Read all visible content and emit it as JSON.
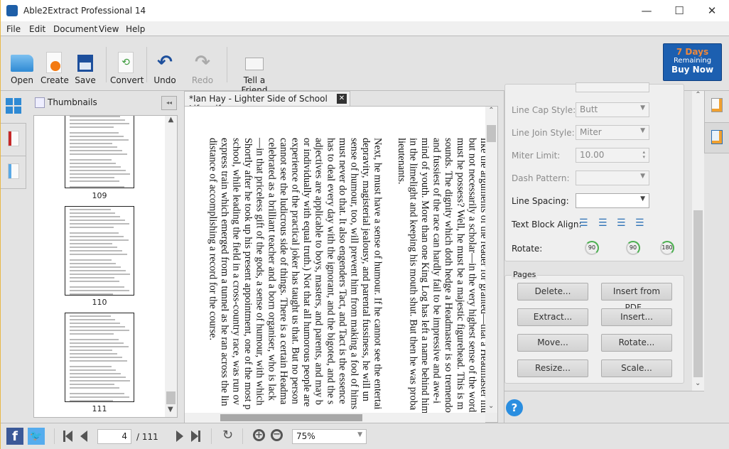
{
  "window": {
    "title": "Able2Extract Professional 14",
    "minimize": "—",
    "maximize": "☐",
    "close": "✕"
  },
  "menu": [
    "File",
    "Edit",
    "Document",
    "View",
    "Help"
  ],
  "toolbar": {
    "open": "Open",
    "create": "Create",
    "save": "Save",
    "convert": "Convert",
    "undo": "Undo",
    "redo": "Redo",
    "tell": "Tell a Friend"
  },
  "buy": {
    "days": "7 Days",
    "remaining": "Remaining",
    "buy": "Buy Now",
    "accent": "#1c5fb0",
    "days_color": "#f0883a"
  },
  "thumbnails": {
    "title": "Thumbnails",
    "collapse": "◂◂",
    "pages": [
      "109",
      "110",
      "111"
    ]
  },
  "document": {
    "tab": "*Ian Hay - Lighter Side of School Life.pdf",
    "lines": [
      "like the arguments of the reader for granted—that a Headmaster must",
      "but not necessarily a scholar—in the very highest sense of the word",
      "must he possess? Well, he must be a majestic figurehead. This is m",
      "sounds. The dignity which doth hedge a Headmaster is so tremendous",
      "and fussiest of the race can hardly fail to be impressive and awe-i",
      "mind of youth. More than one King Log has left a name behind him",
      "in the limelight and keeping his mouth shut. But then he was proba",
      "lieutenants.",
      "",
      "Next, he must have a sense of humour. If he cannot see the entertai",
      "depravity, magisterial jealousy, and parental fussiness, he will un",
      "sense of humour, too, will prevent him from making a fool of hims",
      "must never do that. It also engenders Tact, and Tact is the essence",
      "has to deal every day with the ignorant, and the bigoted, and the s",
      "adjectives are applicable to boys, masters, and parents, and may b",
      "or individually with equal truth.) Not that all humorous people are",
      "experience of the practical joker has taught us that. But no person",
      "cannot see the ludicrous side of things. There is a certain Headma",
      "celebrated as a brilliant teacher and a born organiser, who is lack",
      "—in that priceless gift of the gods, a sense of humour, with which",
      "Shortly after he took up his present appointment, one of the most p",
      "school, while leading the field in a cross-country race, was run ov",
      "express train which emerged from a tunnel as he ran across the lin",
      "distance of accomplishing a record for the course."
    ]
  },
  "properties": {
    "line_cap": {
      "label": "Line Cap Style:",
      "value": "Butt"
    },
    "line_join": {
      "label": "Line Join Style:",
      "value": "Miter"
    },
    "miter": {
      "label": "Miter Limit:",
      "value": "10.00"
    },
    "dash": {
      "label": "Dash Pattern:",
      "value": ""
    },
    "spacing": {
      "label": "Line Spacing:",
      "value": ""
    },
    "align": {
      "label": "Text Block Align:"
    },
    "rotate": {
      "label": "Rotate:",
      "values": [
        "90",
        "90",
        "180"
      ]
    }
  },
  "pages": {
    "title": "Pages",
    "buttons": [
      "Delete...",
      "Insert from PDF...",
      "Extract...",
      "Insert...",
      "Move...",
      "Rotate...",
      "Resize...",
      "Scale..."
    ]
  },
  "status": {
    "page": "4",
    "total": "/ 111",
    "zoom": "75%"
  }
}
